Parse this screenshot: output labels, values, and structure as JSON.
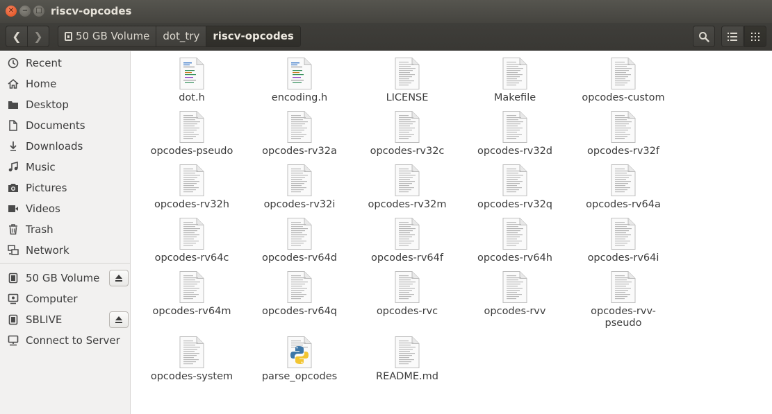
{
  "window": {
    "title": "riscv-opcodes"
  },
  "breadcrumb": [
    "50 GB Volume",
    "dot_try",
    "riscv-opcodes"
  ],
  "sidebar": {
    "places": [
      {
        "label": "Recent",
        "icon": "clock-icon"
      },
      {
        "label": "Home",
        "icon": "home-icon"
      },
      {
        "label": "Desktop",
        "icon": "desktop-folder-icon"
      },
      {
        "label": "Documents",
        "icon": "document-icon"
      },
      {
        "label": "Downloads",
        "icon": "download-icon"
      },
      {
        "label": "Music",
        "icon": "music-icon"
      },
      {
        "label": "Pictures",
        "icon": "camera-icon"
      },
      {
        "label": "Videos",
        "icon": "video-icon"
      },
      {
        "label": "Trash",
        "icon": "trash-icon"
      },
      {
        "label": "Network",
        "icon": "network-icon"
      }
    ],
    "devices": [
      {
        "label": "50 GB Volume",
        "icon": "drive-icon",
        "eject": true
      },
      {
        "label": "Computer",
        "icon": "computer-icon",
        "eject": false
      },
      {
        "label": "SBLIVE",
        "icon": "drive-icon",
        "eject": true
      },
      {
        "label": "Connect to Server",
        "icon": "server-icon",
        "eject": false
      }
    ]
  },
  "files": [
    {
      "name": "dot.h",
      "type": "c-header"
    },
    {
      "name": "encoding.h",
      "type": "c-header"
    },
    {
      "name": "LICENSE",
      "type": "text"
    },
    {
      "name": "Makefile",
      "type": "text"
    },
    {
      "name": "opcodes-custom",
      "type": "text"
    },
    {
      "name": "opcodes-pseudo",
      "type": "text"
    },
    {
      "name": "opcodes-rv32a",
      "type": "text"
    },
    {
      "name": "opcodes-rv32c",
      "type": "text"
    },
    {
      "name": "opcodes-rv32d",
      "type": "text"
    },
    {
      "name": "opcodes-rv32f",
      "type": "text"
    },
    {
      "name": "opcodes-rv32h",
      "type": "text"
    },
    {
      "name": "opcodes-rv32i",
      "type": "text"
    },
    {
      "name": "opcodes-rv32m",
      "type": "text"
    },
    {
      "name": "opcodes-rv32q",
      "type": "text"
    },
    {
      "name": "opcodes-rv64a",
      "type": "text"
    },
    {
      "name": "opcodes-rv64c",
      "type": "text"
    },
    {
      "name": "opcodes-rv64d",
      "type": "text"
    },
    {
      "name": "opcodes-rv64f",
      "type": "text"
    },
    {
      "name": "opcodes-rv64h",
      "type": "text"
    },
    {
      "name": "opcodes-rv64i",
      "type": "text"
    },
    {
      "name": "opcodes-rv64m",
      "type": "text"
    },
    {
      "name": "opcodes-rv64q",
      "type": "text"
    },
    {
      "name": "opcodes-rvc",
      "type": "text"
    },
    {
      "name": "opcodes-rvv",
      "type": "text"
    },
    {
      "name": "opcodes-rvv-\npseudo",
      "type": "text"
    },
    {
      "name": "opcodes-system",
      "type": "text"
    },
    {
      "name": "parse_opcodes",
      "type": "python"
    },
    {
      "name": "README.md",
      "type": "text"
    }
  ]
}
